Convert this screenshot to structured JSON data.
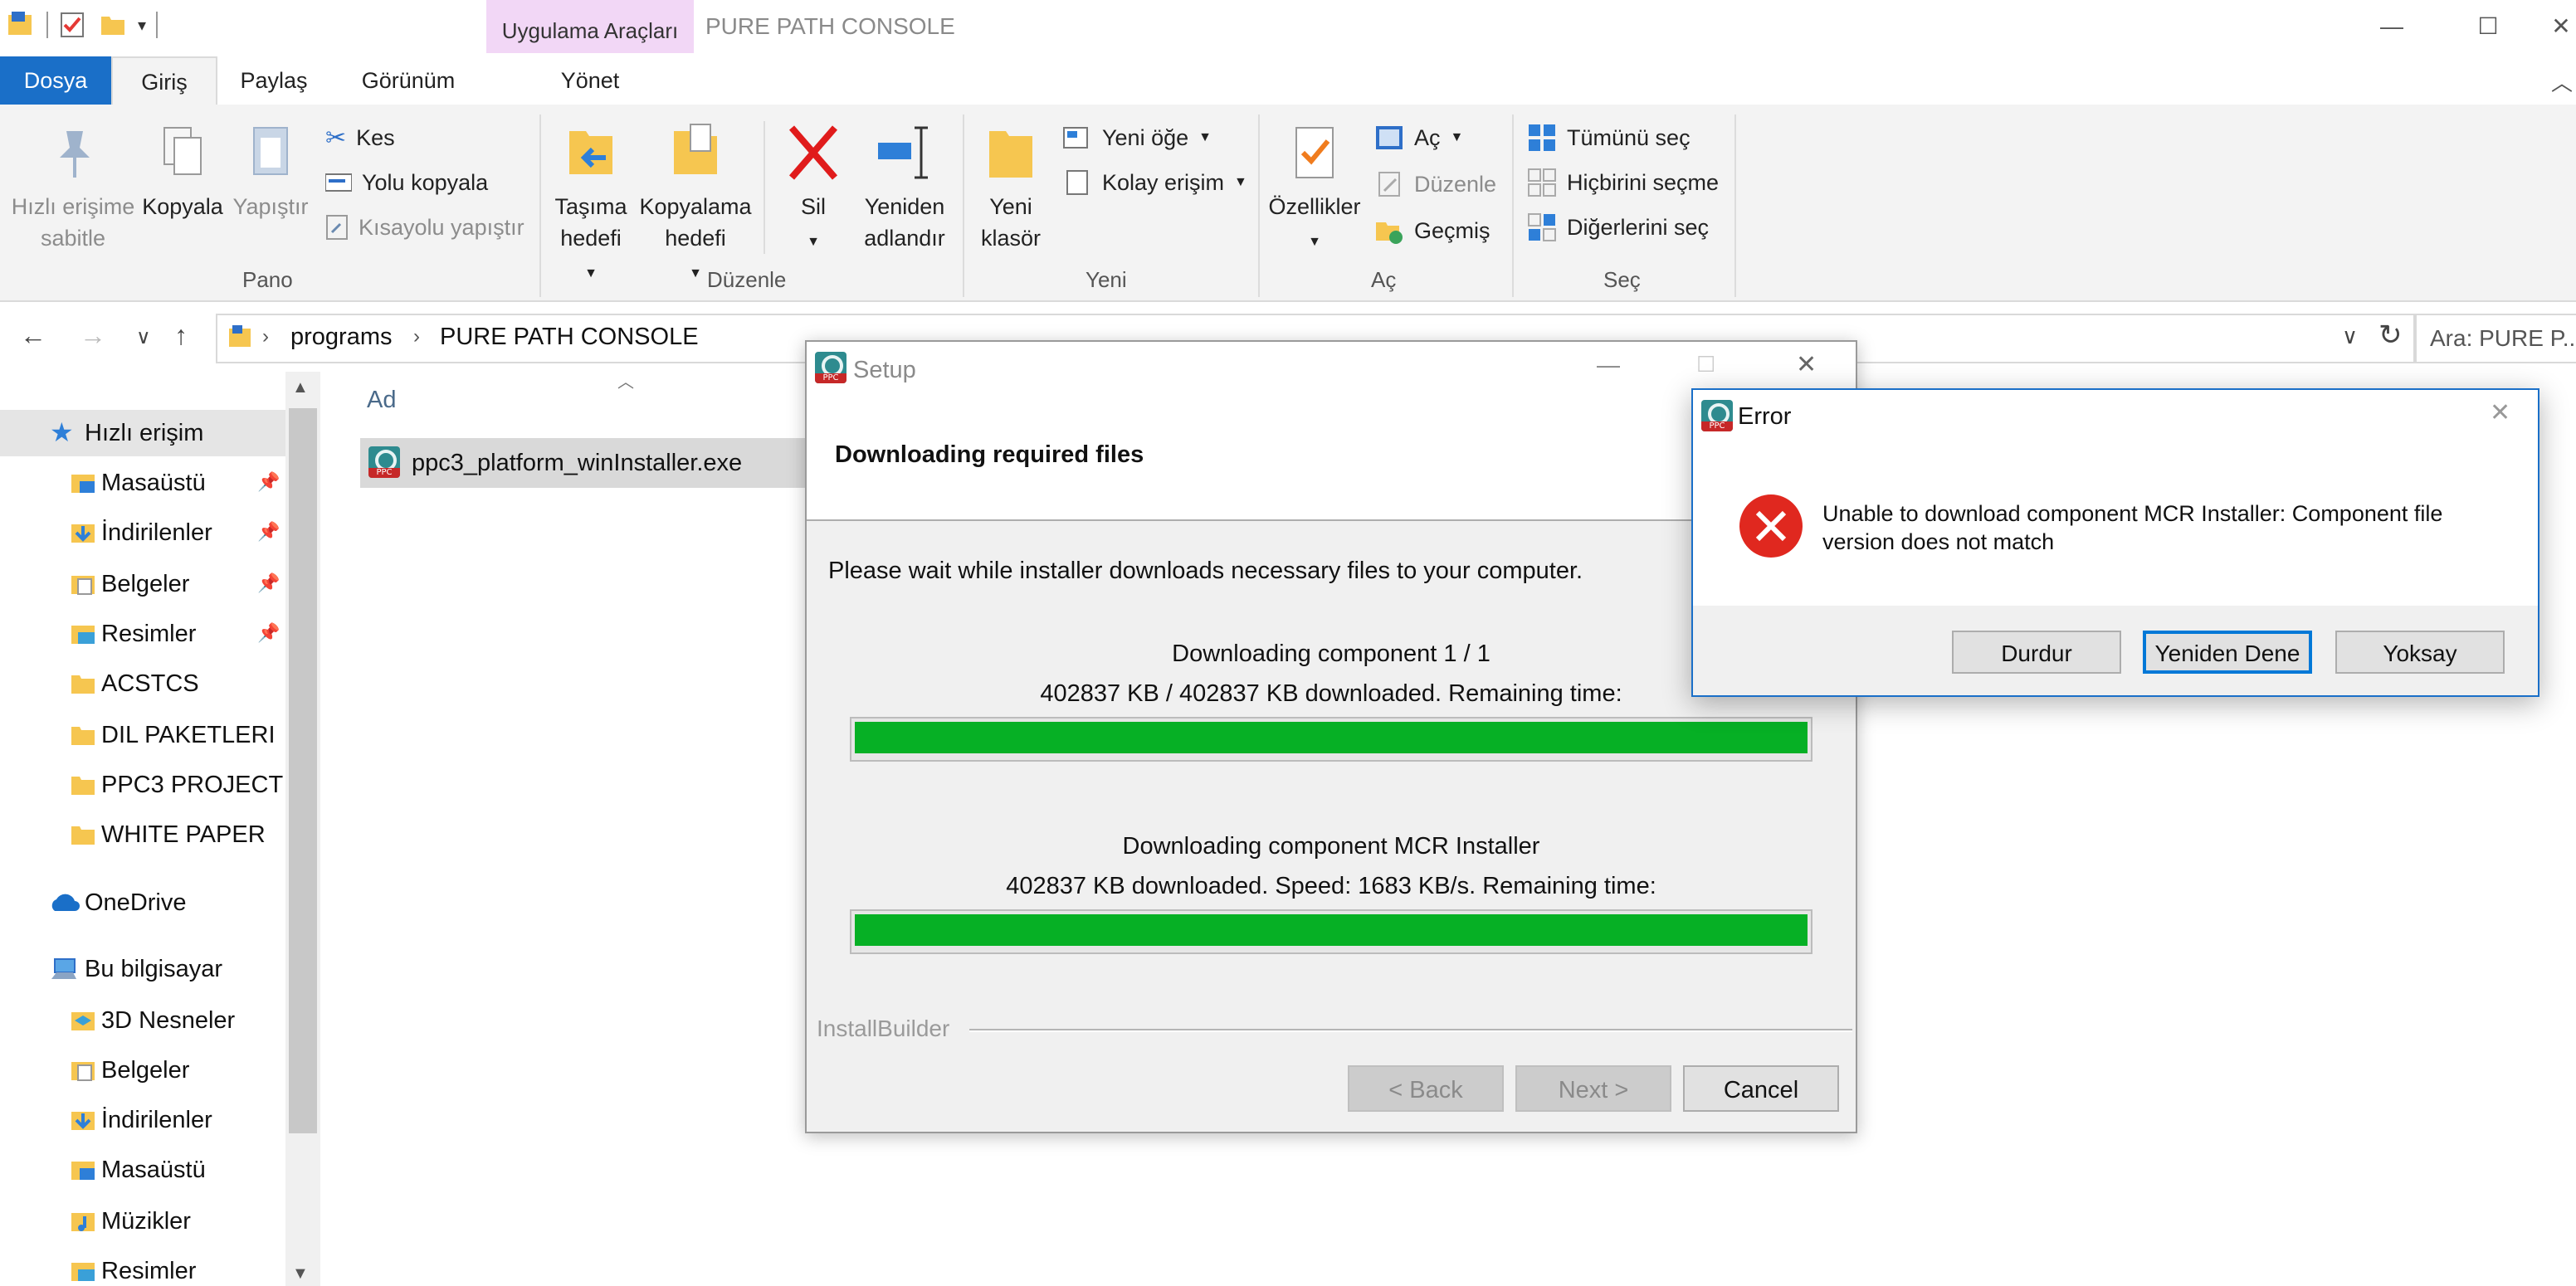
{
  "window": {
    "title": "PURE PATH CONSOLE",
    "context_tab": "Uygulama Araçları",
    "controls": {
      "minimize": "—",
      "maximize": "☐",
      "close": "✕"
    }
  },
  "tabs": [
    "Dosya",
    "Giriş",
    "Paylaş",
    "Görünüm",
    "Yönet"
  ],
  "ribbon": {
    "pano": {
      "label": "Pano",
      "pin": "Hızlı erişime sabitle",
      "copy": "Kopyala",
      "paste": "Yapıştır",
      "cut": "Kes",
      "copy_path": "Yolu kopyala",
      "paste_shortcut": "Kısayolu yapıştır"
    },
    "duzenle": {
      "label": "Düzenle",
      "move_to": "Taşıma hedefi",
      "copy_to": "Kopyalama hedefi",
      "delete": "Sil",
      "rename": "Yeniden adlandır"
    },
    "yeni": {
      "label": "Yeni",
      "new_folder": "Yeni klasör",
      "new_item": "Yeni öğe",
      "easy_access": "Kolay erişim"
    },
    "ac": {
      "label": "Aç",
      "properties": "Özellikler",
      "open": "Aç",
      "edit": "Düzenle",
      "history": "Geçmiş"
    },
    "sec": {
      "label": "Seç",
      "select_all": "Tümünü seç",
      "select_none": "Hiçbirini seçme",
      "invert": "Diğerlerini seç"
    }
  },
  "address": {
    "crumbs": [
      "programs",
      "PURE PATH CONSOLE"
    ],
    "search_placeholder": "Ara: PURE P..."
  },
  "nav": {
    "quick_access": "Hızlı erişim",
    "quick_items": [
      "Masaüstü",
      "İndirilenler",
      "Belgeler",
      "Resimler",
      "ACSTCS",
      "DIL PAKETLERI",
      "PPC3 PROJECT",
      "WHITE PAPER"
    ],
    "onedrive": "OneDrive",
    "this_pc": "Bu bilgisayar",
    "pc_items": [
      "3D Nesneler",
      "Belgeler",
      "İndirilenler",
      "Masaüstü",
      "Müzikler",
      "Resimler"
    ]
  },
  "filelist": {
    "column_name": "Ad",
    "files": [
      "ppc3_platform_winInstaller.exe"
    ]
  },
  "setup": {
    "title": "Setup",
    "header": "Downloading required files",
    "intro": "Please wait while installer downloads necessary files to your computer.",
    "component_1": "Downloading component 1 / 1",
    "progress_1_text": "402837 KB / 402837 KB downloaded. Remaining time:",
    "progress_1": 1.0,
    "component_2": "Downloading component MCR Installer",
    "progress_2_text": "402837 KB downloaded. Speed: 1683 KB/s. Remaining time:",
    "progress_2": 1.0,
    "brand": "InstallBuilder",
    "back": "< Back",
    "next": "Next >",
    "cancel": "Cancel"
  },
  "error": {
    "title": "Error",
    "message": "Unable to download component MCR Installer: Component file version does not match",
    "abort": "Durdur",
    "retry": "Yeniden Dene",
    "ignore": "Yoksay"
  }
}
